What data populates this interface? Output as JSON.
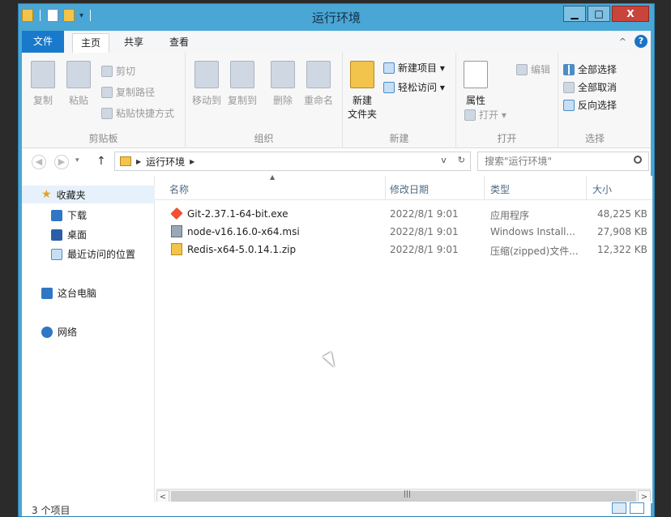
{
  "window": {
    "title": "运行环境",
    "controls": {
      "minimize": "▁",
      "maximize": "□",
      "close": "X"
    }
  },
  "tabs": {
    "file": "文件",
    "home": "主页",
    "share": "共享",
    "view": "查看",
    "help": "?"
  },
  "ribbon": {
    "clipboard": {
      "label": "剪贴板",
      "copy": "复制",
      "paste": "粘贴",
      "cut": "剪切",
      "copy_path": "复制路径",
      "paste_shortcut": "粘贴快捷方式"
    },
    "organize": {
      "label": "组织",
      "move_to": "移动到",
      "copy_to": "复制到",
      "delete": "删除",
      "rename": "重命名"
    },
    "new": {
      "label": "新建",
      "new_folder_line1": "新建",
      "new_folder_line2": "文件夹",
      "new_item": "新建项目 ▾",
      "easy_access": "轻松访问 ▾"
    },
    "open": {
      "label": "打开",
      "properties": "属性",
      "open": "打开 ▾",
      "edit": "编辑"
    },
    "select": {
      "label": "选择",
      "select_all": "全部选择",
      "select_none": "全部取消",
      "invert": "反向选择"
    }
  },
  "address": {
    "path": "运行环境",
    "search_placeholder": "搜索\"运行环境\""
  },
  "nav": {
    "favorites": "收藏夹",
    "downloads": "下载",
    "desktop": "桌面",
    "recent": "最近访问的位置",
    "this_pc": "这台电脑",
    "network": "网络"
  },
  "columns": {
    "name": "名称",
    "modified": "修改日期",
    "type": "类型",
    "size": "大小"
  },
  "files": [
    {
      "name": "Git-2.37.1-64-bit.exe",
      "modified": "2022/8/1 9:01",
      "type": "应用程序",
      "size": "48,225 KB",
      "icon": "git-icon"
    },
    {
      "name": "node-v16.16.0-x64.msi",
      "modified": "2022/8/1 9:01",
      "type": "Windows Install...",
      "size": "27,908 KB",
      "icon": "msi-icon"
    },
    {
      "name": "Redis-x64-5.0.14.1.zip",
      "modified": "2022/8/1 9:01",
      "type": "压缩(zipped)文件...",
      "size": "12,322 KB",
      "icon": "zip-icon"
    }
  ],
  "status": {
    "count": "3 个项目"
  },
  "colors": {
    "title_bar": "#4aa6d4",
    "file_tab": "#1979ca",
    "close_button": "#c9443b"
  }
}
